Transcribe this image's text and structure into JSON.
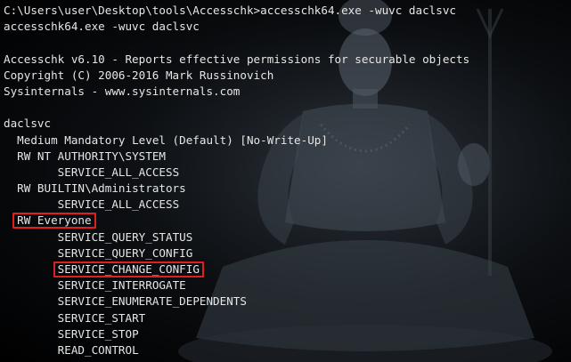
{
  "colors": {
    "background": "#000000",
    "text": "#e6e6e6",
    "highlight_border": "#e02020"
  },
  "background_art": "meditating-deity-silhouette",
  "terminal": {
    "lines": [
      {
        "indent": "",
        "text": "C:\\Users\\user\\Desktop\\tools\\Accesschk>accesschk64.exe -wuvc daclsvc",
        "highlight": false
      },
      {
        "indent": "",
        "text": "accesschk64.exe -wuvc daclsvc",
        "highlight": false
      },
      {
        "indent": "",
        "text": "",
        "highlight": false
      },
      {
        "indent": "",
        "text": "Accesschk v6.10 - Reports effective permissions for securable objects",
        "highlight": false
      },
      {
        "indent": "",
        "text": "Copyright (C) 2006-2016 Mark Russinovich",
        "highlight": false
      },
      {
        "indent": "",
        "text": "Sysinternals - www.sysinternals.com",
        "highlight": false
      },
      {
        "indent": "",
        "text": "",
        "highlight": false
      },
      {
        "indent": "",
        "text": "daclsvc",
        "highlight": false
      },
      {
        "indent": "  ",
        "text": "Medium Mandatory Level (Default) [No-Write-Up]",
        "highlight": false
      },
      {
        "indent": "  ",
        "text": "RW NT AUTHORITY\\SYSTEM",
        "highlight": false
      },
      {
        "indent": "        ",
        "text": "SERVICE_ALL_ACCESS",
        "highlight": false
      },
      {
        "indent": "  ",
        "text": "RW BUILTIN\\Administrators",
        "highlight": false
      },
      {
        "indent": "        ",
        "text": "SERVICE_ALL_ACCESS",
        "highlight": false
      },
      {
        "indent": "  ",
        "text": "RW Everyone",
        "highlight": true
      },
      {
        "indent": "        ",
        "text": "SERVICE_QUERY_STATUS",
        "highlight": false
      },
      {
        "indent": "        ",
        "text": "SERVICE_QUERY_CONFIG",
        "highlight": false
      },
      {
        "indent": "        ",
        "text": "SERVICE_CHANGE_CONFIG",
        "highlight": true
      },
      {
        "indent": "        ",
        "text": "SERVICE_INTERROGATE",
        "highlight": false
      },
      {
        "indent": "        ",
        "text": "SERVICE_ENUMERATE_DEPENDENTS",
        "highlight": false
      },
      {
        "indent": "        ",
        "text": "SERVICE_START",
        "highlight": false
      },
      {
        "indent": "        ",
        "text": "SERVICE_STOP",
        "highlight": false
      },
      {
        "indent": "        ",
        "text": "READ_CONTROL",
        "highlight": false
      }
    ]
  }
}
